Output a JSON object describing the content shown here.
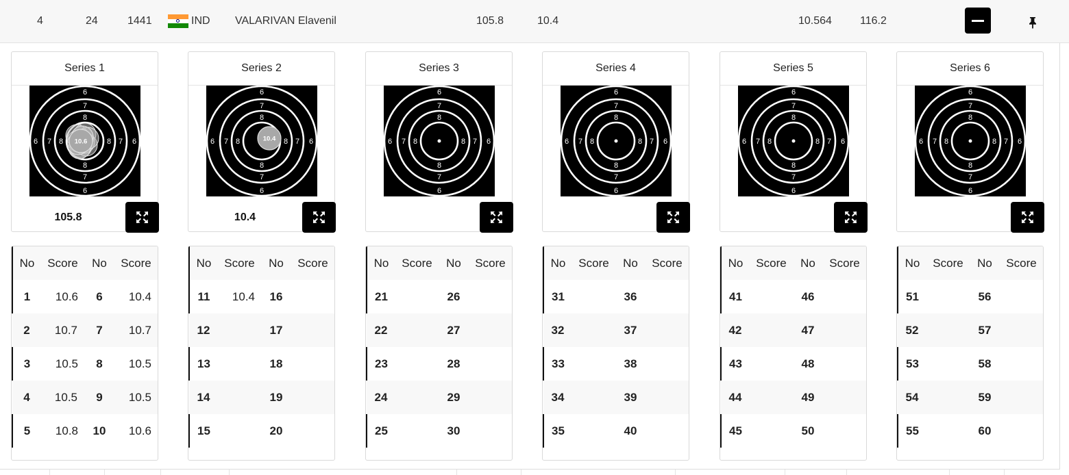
{
  "header": {
    "rank": "4",
    "bib": "24",
    "id": "1441",
    "country_code": "IND",
    "athlete_name": "VALARIVAN Elavenil",
    "total": "105.8",
    "series_value": "10.4",
    "average": "10.564",
    "projected": "116.2",
    "flag_colors": [
      "#ff9933",
      "#ffffff",
      "#138808"
    ],
    "collapse_icon": "minus-icon",
    "pin_icon": "pin-icon"
  },
  "target": {
    "ring_labels": [
      "6",
      "7",
      "8"
    ]
  },
  "series": [
    {
      "title": "Series 1",
      "total": "105.8",
      "shots_on_target": [
        "10.6",
        "10.7",
        "10.5",
        "10.5",
        "10.8",
        "10.4",
        "10.7",
        "10.5",
        "10.5",
        "10.6"
      ],
      "featured_shot": "10.6",
      "table": {
        "headers": [
          "No",
          "Score",
          "No",
          "Score"
        ],
        "rows": [
          [
            "1",
            "10.6",
            "6",
            "10.4"
          ],
          [
            "2",
            "10.7",
            "7",
            "10.7"
          ],
          [
            "3",
            "10.5",
            "8",
            "10.5"
          ],
          [
            "4",
            "10.5",
            "9",
            "10.5"
          ],
          [
            "5",
            "10.8",
            "10",
            "10.6"
          ]
        ]
      }
    },
    {
      "title": "Series 2",
      "total": "10.4",
      "shots_on_target": [
        "10.4"
      ],
      "featured_shot": "10.4",
      "table": {
        "headers": [
          "No",
          "Score",
          "No",
          "Score"
        ],
        "rows": [
          [
            "11",
            "10.4",
            "16",
            ""
          ],
          [
            "12",
            "",
            "17",
            ""
          ],
          [
            "13",
            "",
            "18",
            ""
          ],
          [
            "14",
            "",
            "19",
            ""
          ],
          [
            "15",
            "",
            "20",
            ""
          ]
        ]
      }
    },
    {
      "title": "Series 3",
      "total": "",
      "shots_on_target": [],
      "featured_shot": "",
      "table": {
        "headers": [
          "No",
          "Score",
          "No",
          "Score"
        ],
        "rows": [
          [
            "21",
            "",
            "26",
            ""
          ],
          [
            "22",
            "",
            "27",
            ""
          ],
          [
            "23",
            "",
            "28",
            ""
          ],
          [
            "24",
            "",
            "29",
            ""
          ],
          [
            "25",
            "",
            "30",
            ""
          ]
        ]
      }
    },
    {
      "title": "Series 4",
      "total": "",
      "shots_on_target": [],
      "featured_shot": "",
      "table": {
        "headers": [
          "No",
          "Score",
          "No",
          "Score"
        ],
        "rows": [
          [
            "31",
            "",
            "36",
            ""
          ],
          [
            "32",
            "",
            "37",
            ""
          ],
          [
            "33",
            "",
            "38",
            ""
          ],
          [
            "34",
            "",
            "39",
            ""
          ],
          [
            "35",
            "",
            "40",
            ""
          ]
        ]
      }
    },
    {
      "title": "Series 5",
      "total": "",
      "shots_on_target": [],
      "featured_shot": "",
      "table": {
        "headers": [
          "No",
          "Score",
          "No",
          "Score"
        ],
        "rows": [
          [
            "41",
            "",
            "46",
            ""
          ],
          [
            "42",
            "",
            "47",
            ""
          ],
          [
            "43",
            "",
            "48",
            ""
          ],
          [
            "44",
            "",
            "49",
            ""
          ],
          [
            "45",
            "",
            "50",
            ""
          ]
        ]
      }
    },
    {
      "title": "Series 6",
      "total": "",
      "shots_on_target": [],
      "featured_shot": "",
      "table": {
        "headers": [
          "No",
          "Score",
          "No",
          "Score"
        ],
        "rows": [
          [
            "51",
            "",
            "56",
            ""
          ],
          [
            "52",
            "",
            "57",
            ""
          ],
          [
            "53",
            "",
            "58",
            ""
          ],
          [
            "54",
            "",
            "59",
            ""
          ],
          [
            "55",
            "",
            "60",
            ""
          ]
        ]
      }
    }
  ],
  "icons": {
    "expand": "expand-icon"
  }
}
